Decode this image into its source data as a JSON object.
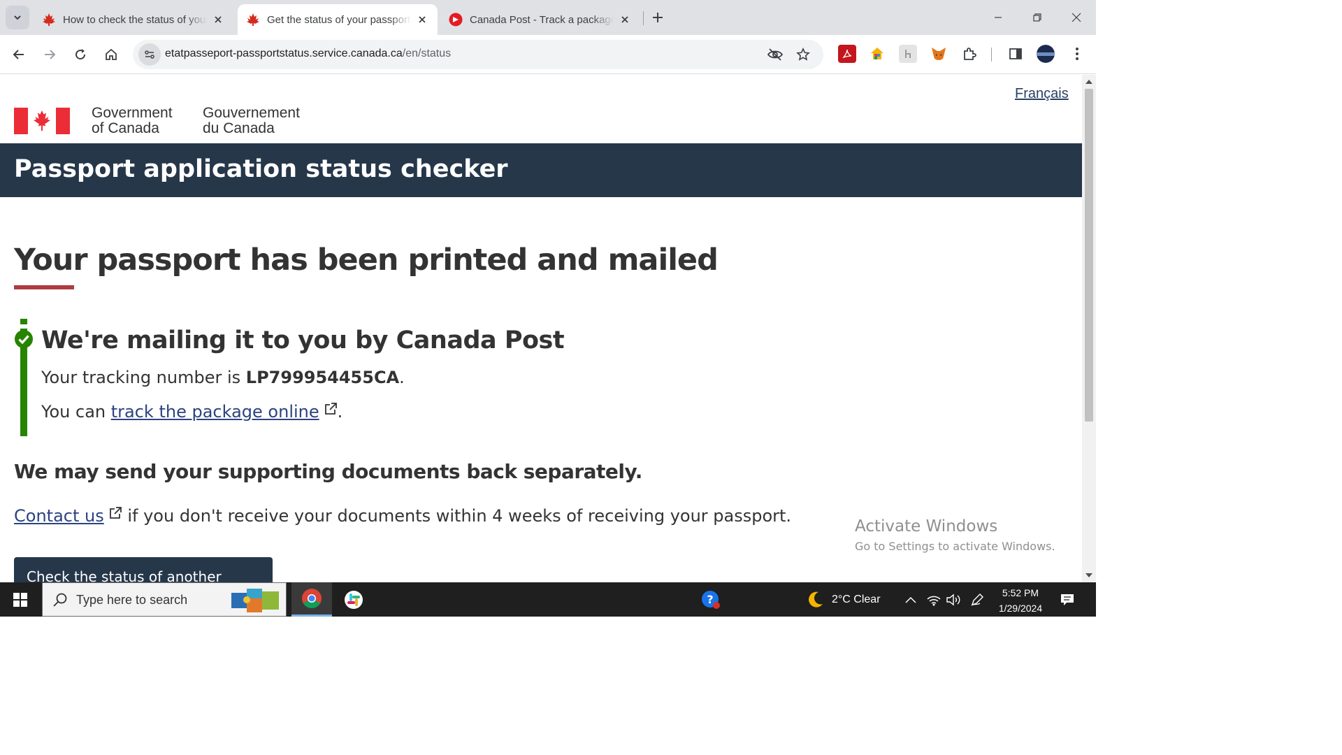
{
  "browser": {
    "tabs": [
      {
        "title": "How to check the status of your"
      },
      {
        "title": "Get the status of your passport"
      },
      {
        "title": "Canada Post - Track a package b"
      }
    ],
    "url_host": "etatpasseport-passportstatus.service.canada.ca",
    "url_path": "/en/status"
  },
  "page": {
    "lang_toggle": "Français",
    "gov_en_line1": "Government",
    "gov_en_line2": "of Canada",
    "gov_fr_line1": "Gouvernement",
    "gov_fr_line2": "du Canada",
    "banner_title": "Passport application status checker",
    "heading": "Your passport has been printed and mailed",
    "status_heading": "We're mailing it to you by Canada Post",
    "tracking_prefix": "Your tracking number is ",
    "tracking_number": "LP799954455CA",
    "tracking_suffix": ".",
    "track_prefix": "You can ",
    "track_link": "track the package online",
    "track_suffix": ".",
    "documents_heading": "We may send your supporting documents back separately.",
    "contact_link": "Contact us",
    "contact_text": " if you don't receive your documents within 4 weeks of receiving your passport.",
    "button_label": "Check the status of another application"
  },
  "watermark": {
    "line1": "Activate Windows",
    "line2": "Go to Settings to activate Windows."
  },
  "taskbar": {
    "search_placeholder": "Type here to search",
    "weather": "2°C  Clear",
    "time": "5:52 PM",
    "date": "1/29/2024"
  },
  "colors": {
    "banner": "#26374a",
    "accent_rule": "#af3c43",
    "success": "#278400",
    "link": "#2b4380",
    "flag_red": "#eb2d37"
  }
}
